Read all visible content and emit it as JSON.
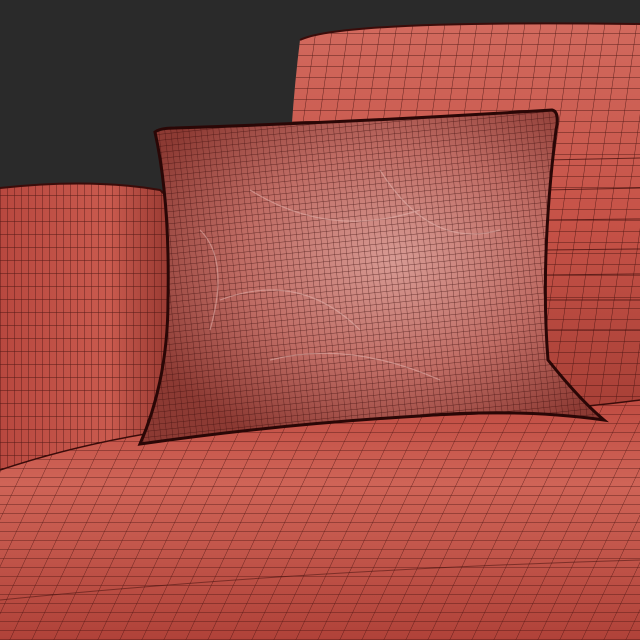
{
  "viewport": {
    "background_color": "#2a2a2a",
    "shading_mode": "wireframe-over-shaded"
  },
  "colors": {
    "upholstery": "#c8554a",
    "upholstery_shadow": "#8a2f28",
    "upholstery_highlight": "#d9766a",
    "pillow": "#b9605a",
    "pillow_highlight": "#d89a94",
    "wire": "#3a0c0a"
  },
  "objects": [
    {
      "name": "sofa-back-cushion",
      "description": ""
    },
    {
      "name": "sofa-armrest",
      "description": ""
    },
    {
      "name": "throw-pillow",
      "description": ""
    },
    {
      "name": "sofa-seat",
      "description": ""
    }
  ]
}
